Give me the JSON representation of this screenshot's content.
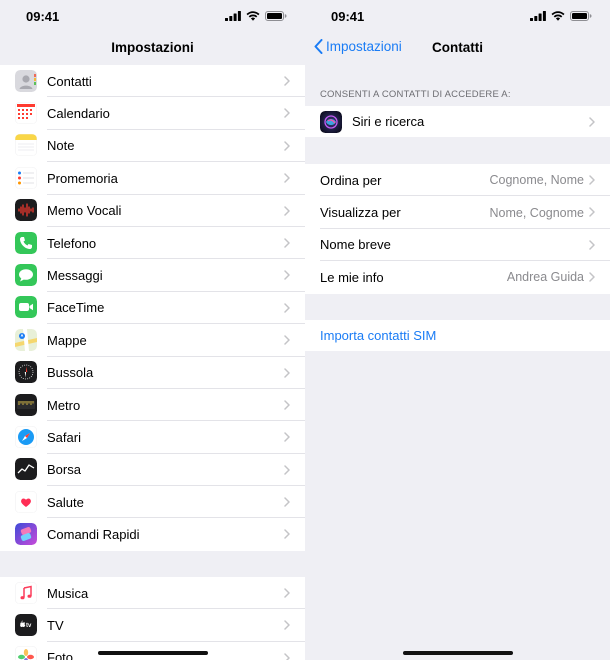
{
  "left": {
    "status": {
      "time": "09:41"
    },
    "title": "Impostazioni",
    "group1": [
      {
        "label": "Contatti",
        "icon": "contacts-icon"
      },
      {
        "label": "Calendario",
        "icon": "calendar-icon"
      },
      {
        "label": "Note",
        "icon": "notes-icon"
      },
      {
        "label": "Promemoria",
        "icon": "reminders-icon"
      },
      {
        "label": "Memo Vocali",
        "icon": "voice-memos-icon"
      },
      {
        "label": "Telefono",
        "icon": "phone-icon"
      },
      {
        "label": "Messaggi",
        "icon": "messages-icon"
      },
      {
        "label": "FaceTime",
        "icon": "facetime-icon"
      },
      {
        "label": "Mappe",
        "icon": "maps-icon"
      },
      {
        "label": "Bussola",
        "icon": "compass-icon"
      },
      {
        "label": "Metro",
        "icon": "measure-icon"
      },
      {
        "label": "Safari",
        "icon": "safari-icon"
      },
      {
        "label": "Borsa",
        "icon": "stocks-icon"
      },
      {
        "label": "Salute",
        "icon": "health-icon"
      },
      {
        "label": "Comandi Rapidi",
        "icon": "shortcuts-icon"
      }
    ],
    "group2": [
      {
        "label": "Musica",
        "icon": "music-icon"
      },
      {
        "label": "TV",
        "icon": "tv-icon"
      },
      {
        "label": "Foto",
        "icon": "photos-icon"
      }
    ]
  },
  "right": {
    "status": {
      "time": "09:41"
    },
    "back_label": "Impostazioni",
    "title": "Contatti",
    "section_header": "CONSENTI A CONTATTI DI ACCEDERE A:",
    "siri_label": "Siri e ricerca",
    "settings": [
      {
        "label": "Ordina per",
        "value": "Cognome, Nome"
      },
      {
        "label": "Visualizza per",
        "value": "Nome, Cognome"
      },
      {
        "label": "Nome breve",
        "value": ""
      },
      {
        "label": "Le mie info",
        "value": "Andrea Guida"
      }
    ],
    "import_label": "Importa contatti SIM"
  },
  "colors": {
    "accent": "#1a7cf5",
    "background": "#efeff4",
    "separator": "#e3e3e8",
    "secondary_text": "#8a8a8e"
  }
}
